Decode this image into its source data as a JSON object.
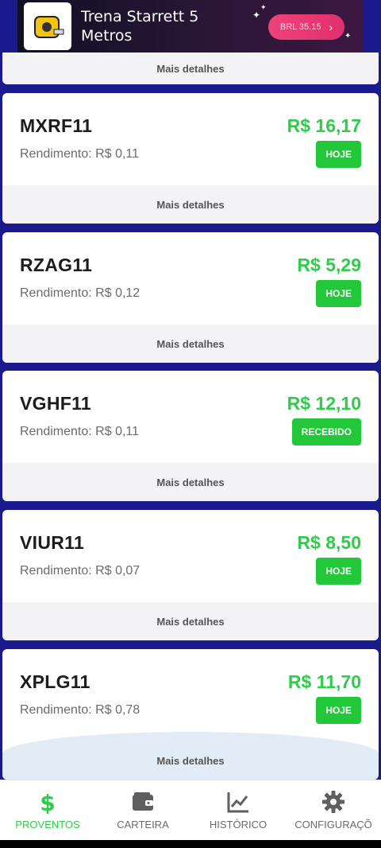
{
  "ad": {
    "title": "Trena Starrett 5 Metros",
    "button_label": "BRL 35.15",
    "thumb_icon": "tape-measure-icon"
  },
  "partial_card": {
    "details_label": "Mais detalhes"
  },
  "cards": [
    {
      "ticker": "MXRF11",
      "yield": "Rendimento: R$ 0,11",
      "amount": "R$ 16,17",
      "status": "HOJE",
      "details_label": "Mais detalhes"
    },
    {
      "ticker": "RZAG11",
      "yield": "Rendimento: R$ 0,12",
      "amount": "R$ 5,29",
      "status": "HOJE",
      "details_label": "Mais detalhes"
    },
    {
      "ticker": "VGHF11",
      "yield": "Rendimento: R$ 0,11",
      "amount": "R$ 12,10",
      "status": "RECEBIDO",
      "details_label": "Mais detalhes"
    },
    {
      "ticker": "VIUR11",
      "yield": "Rendimento: R$ 0,07",
      "amount": "R$ 8,50",
      "status": "HOJE",
      "details_label": "Mais detalhes"
    },
    {
      "ticker": "XPLG11",
      "yield": "Rendimento: R$ 0,78",
      "amount": "R$ 11,70",
      "status": "HOJE",
      "details_label": "Mais detalhes"
    }
  ],
  "nav": {
    "items": [
      {
        "label": "PROVENTOS",
        "icon": "dollar-icon",
        "active": true
      },
      {
        "label": "CARTEIRA",
        "icon": "wallet-icon",
        "active": false
      },
      {
        "label": "HISTÓRICO",
        "icon": "chart-line-icon",
        "active": false
      },
      {
        "label": "CONFIGURAÇÕ",
        "icon": "gear-icon",
        "active": false
      }
    ]
  },
  "colors": {
    "background": "#1b1a8c",
    "accent_green": "#2ecc4a",
    "badge_green": "#22c83a"
  }
}
